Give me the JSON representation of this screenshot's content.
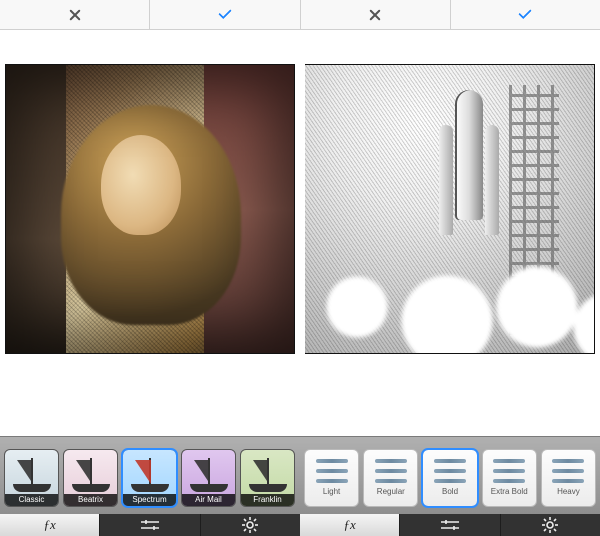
{
  "topbar": {
    "left": {
      "cancel": "✕",
      "confirm": "✓"
    },
    "right": {
      "cancel": "✕",
      "confirm": "✓"
    }
  },
  "previews": {
    "left": {
      "description": "Color halftone portrait (Spectrum filter)"
    },
    "right": {
      "description": "Monochrome engraved space shuttle (Bold intensity)"
    }
  },
  "filters": {
    "selected_index": 2,
    "items": [
      {
        "label": "Classic",
        "tint": "classic"
      },
      {
        "label": "Beatrix",
        "tint": "beatrix"
      },
      {
        "label": "Spectrum",
        "tint": "spectrum"
      },
      {
        "label": "Air Mail",
        "tint": "airmail"
      },
      {
        "label": "Franklin",
        "tint": "franklin"
      }
    ]
  },
  "intensity": {
    "selected_index": 2,
    "items": [
      {
        "label": "Light"
      },
      {
        "label": "Regular"
      },
      {
        "label": "Bold"
      },
      {
        "label": "Extra Bold"
      },
      {
        "label": "Heavy"
      }
    ]
  },
  "tabs": {
    "left": {
      "active_index": 0,
      "items": [
        "fx",
        "adjust",
        "brightness"
      ]
    },
    "right": {
      "active_index": 0,
      "items": [
        "fx",
        "adjust",
        "brightness"
      ]
    }
  }
}
